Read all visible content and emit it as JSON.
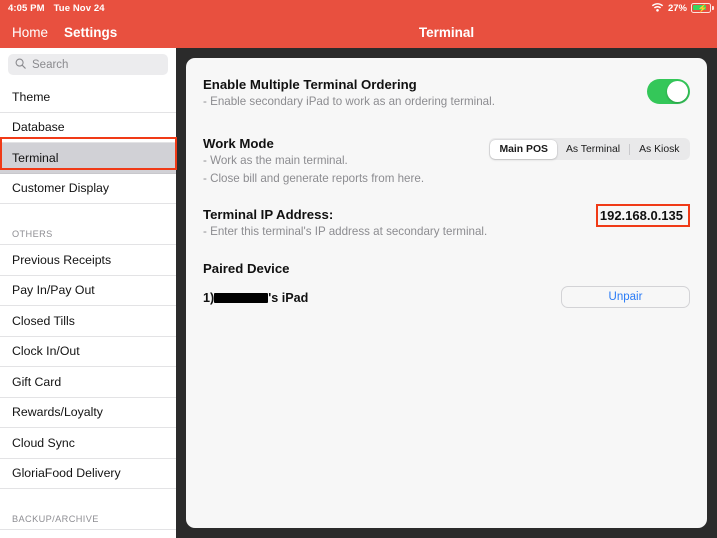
{
  "statusbar": {
    "time": "4:05 PM",
    "date": "Tue Nov 24",
    "wifi_icon": "wifi-icon",
    "battery_percent": "27%",
    "battery_icon": "battery-charging-icon"
  },
  "nav": {
    "home_label": "Home",
    "settings_label": "Settings"
  },
  "header": {
    "title": "Terminal"
  },
  "search": {
    "placeholder": "Search",
    "icon": "search-icon",
    "value": ""
  },
  "sidebar": {
    "items": [
      {
        "label": "Theme",
        "selected": false
      },
      {
        "label": "Database",
        "selected": false
      },
      {
        "label": "Terminal",
        "selected": true
      },
      {
        "label": "Customer Display",
        "selected": false
      }
    ],
    "others_header": "OTHERS",
    "others_items": [
      {
        "label": "Previous Receipts"
      },
      {
        "label": "Pay In/Pay Out"
      },
      {
        "label": "Closed Tills"
      },
      {
        "label": "Clock In/Out"
      },
      {
        "label": "Gift Card"
      },
      {
        "label": "Rewards/Loyalty"
      },
      {
        "label": "Cloud Sync"
      },
      {
        "label": "GloriaFood Delivery"
      }
    ],
    "backup_header": "BACKUP/ARCHIVE"
  },
  "main": {
    "enable_multi": {
      "title": "Enable Multiple Terminal Ordering",
      "subtitle": "- Enable secondary iPad to work as an ordering terminal.",
      "toggle_on": true
    },
    "work_mode": {
      "title": "Work Mode",
      "subtitle_line1": "- Work as the main terminal.",
      "subtitle_line2": "- Close bill and generate reports from here.",
      "options": [
        "Main POS",
        "As Terminal",
        "As Kiosk"
      ],
      "selected": "Main POS"
    },
    "terminal_ip": {
      "title": "Terminal IP Address:",
      "subtitle": "- Enter this terminal's IP address at secondary terminal.",
      "value": "192.168.0.135"
    },
    "paired_device": {
      "title": "Paired Device",
      "index_label": "1)",
      "name_suffix": "'s iPad",
      "name_redacted": true,
      "unpair_label": "Unpair"
    }
  },
  "colors": {
    "accent_red": "#e8503f",
    "annotation_red": "#f03a17",
    "toggle_green": "#34c759",
    "link_blue": "#2a7bf6",
    "selected_row": "#d1d1d6"
  }
}
